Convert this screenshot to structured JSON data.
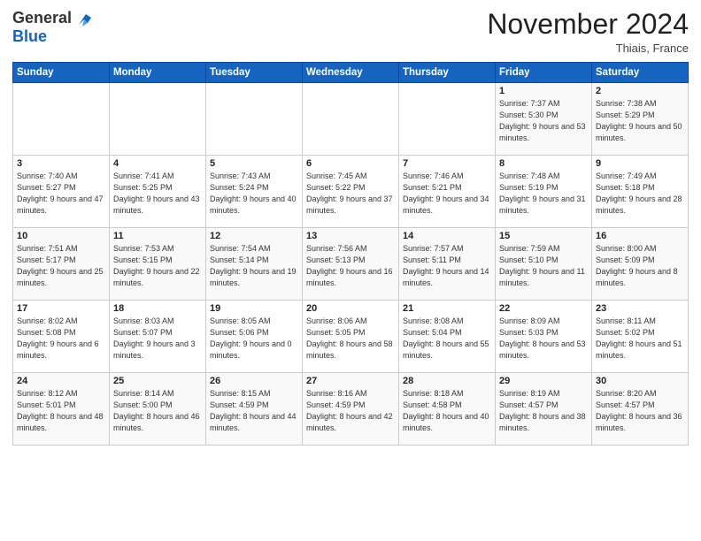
{
  "header": {
    "logo_general": "General",
    "logo_blue": "Blue",
    "month_title": "November 2024",
    "location": "Thiais, France"
  },
  "weekdays": [
    "Sunday",
    "Monday",
    "Tuesday",
    "Wednesday",
    "Thursday",
    "Friday",
    "Saturday"
  ],
  "weeks": [
    [
      {
        "day": "",
        "info": ""
      },
      {
        "day": "",
        "info": ""
      },
      {
        "day": "",
        "info": ""
      },
      {
        "day": "",
        "info": ""
      },
      {
        "day": "",
        "info": ""
      },
      {
        "day": "1",
        "info": "Sunrise: 7:37 AM\nSunset: 5:30 PM\nDaylight: 9 hours and 53 minutes."
      },
      {
        "day": "2",
        "info": "Sunrise: 7:38 AM\nSunset: 5:29 PM\nDaylight: 9 hours and 50 minutes."
      }
    ],
    [
      {
        "day": "3",
        "info": "Sunrise: 7:40 AM\nSunset: 5:27 PM\nDaylight: 9 hours and 47 minutes."
      },
      {
        "day": "4",
        "info": "Sunrise: 7:41 AM\nSunset: 5:25 PM\nDaylight: 9 hours and 43 minutes."
      },
      {
        "day": "5",
        "info": "Sunrise: 7:43 AM\nSunset: 5:24 PM\nDaylight: 9 hours and 40 minutes."
      },
      {
        "day": "6",
        "info": "Sunrise: 7:45 AM\nSunset: 5:22 PM\nDaylight: 9 hours and 37 minutes."
      },
      {
        "day": "7",
        "info": "Sunrise: 7:46 AM\nSunset: 5:21 PM\nDaylight: 9 hours and 34 minutes."
      },
      {
        "day": "8",
        "info": "Sunrise: 7:48 AM\nSunset: 5:19 PM\nDaylight: 9 hours and 31 minutes."
      },
      {
        "day": "9",
        "info": "Sunrise: 7:49 AM\nSunset: 5:18 PM\nDaylight: 9 hours and 28 minutes."
      }
    ],
    [
      {
        "day": "10",
        "info": "Sunrise: 7:51 AM\nSunset: 5:17 PM\nDaylight: 9 hours and 25 minutes."
      },
      {
        "day": "11",
        "info": "Sunrise: 7:53 AM\nSunset: 5:15 PM\nDaylight: 9 hours and 22 minutes."
      },
      {
        "day": "12",
        "info": "Sunrise: 7:54 AM\nSunset: 5:14 PM\nDaylight: 9 hours and 19 minutes."
      },
      {
        "day": "13",
        "info": "Sunrise: 7:56 AM\nSunset: 5:13 PM\nDaylight: 9 hours and 16 minutes."
      },
      {
        "day": "14",
        "info": "Sunrise: 7:57 AM\nSunset: 5:11 PM\nDaylight: 9 hours and 14 minutes."
      },
      {
        "day": "15",
        "info": "Sunrise: 7:59 AM\nSunset: 5:10 PM\nDaylight: 9 hours and 11 minutes."
      },
      {
        "day": "16",
        "info": "Sunrise: 8:00 AM\nSunset: 5:09 PM\nDaylight: 9 hours and 8 minutes."
      }
    ],
    [
      {
        "day": "17",
        "info": "Sunrise: 8:02 AM\nSunset: 5:08 PM\nDaylight: 9 hours and 6 minutes."
      },
      {
        "day": "18",
        "info": "Sunrise: 8:03 AM\nSunset: 5:07 PM\nDaylight: 9 hours and 3 minutes."
      },
      {
        "day": "19",
        "info": "Sunrise: 8:05 AM\nSunset: 5:06 PM\nDaylight: 9 hours and 0 minutes."
      },
      {
        "day": "20",
        "info": "Sunrise: 8:06 AM\nSunset: 5:05 PM\nDaylight: 8 hours and 58 minutes."
      },
      {
        "day": "21",
        "info": "Sunrise: 8:08 AM\nSunset: 5:04 PM\nDaylight: 8 hours and 55 minutes."
      },
      {
        "day": "22",
        "info": "Sunrise: 8:09 AM\nSunset: 5:03 PM\nDaylight: 8 hours and 53 minutes."
      },
      {
        "day": "23",
        "info": "Sunrise: 8:11 AM\nSunset: 5:02 PM\nDaylight: 8 hours and 51 minutes."
      }
    ],
    [
      {
        "day": "24",
        "info": "Sunrise: 8:12 AM\nSunset: 5:01 PM\nDaylight: 8 hours and 48 minutes."
      },
      {
        "day": "25",
        "info": "Sunrise: 8:14 AM\nSunset: 5:00 PM\nDaylight: 8 hours and 46 minutes."
      },
      {
        "day": "26",
        "info": "Sunrise: 8:15 AM\nSunset: 4:59 PM\nDaylight: 8 hours and 44 minutes."
      },
      {
        "day": "27",
        "info": "Sunrise: 8:16 AM\nSunset: 4:59 PM\nDaylight: 8 hours and 42 minutes."
      },
      {
        "day": "28",
        "info": "Sunrise: 8:18 AM\nSunset: 4:58 PM\nDaylight: 8 hours and 40 minutes."
      },
      {
        "day": "29",
        "info": "Sunrise: 8:19 AM\nSunset: 4:57 PM\nDaylight: 8 hours and 38 minutes."
      },
      {
        "day": "30",
        "info": "Sunrise: 8:20 AM\nSunset: 4:57 PM\nDaylight: 8 hours and 36 minutes."
      }
    ]
  ]
}
